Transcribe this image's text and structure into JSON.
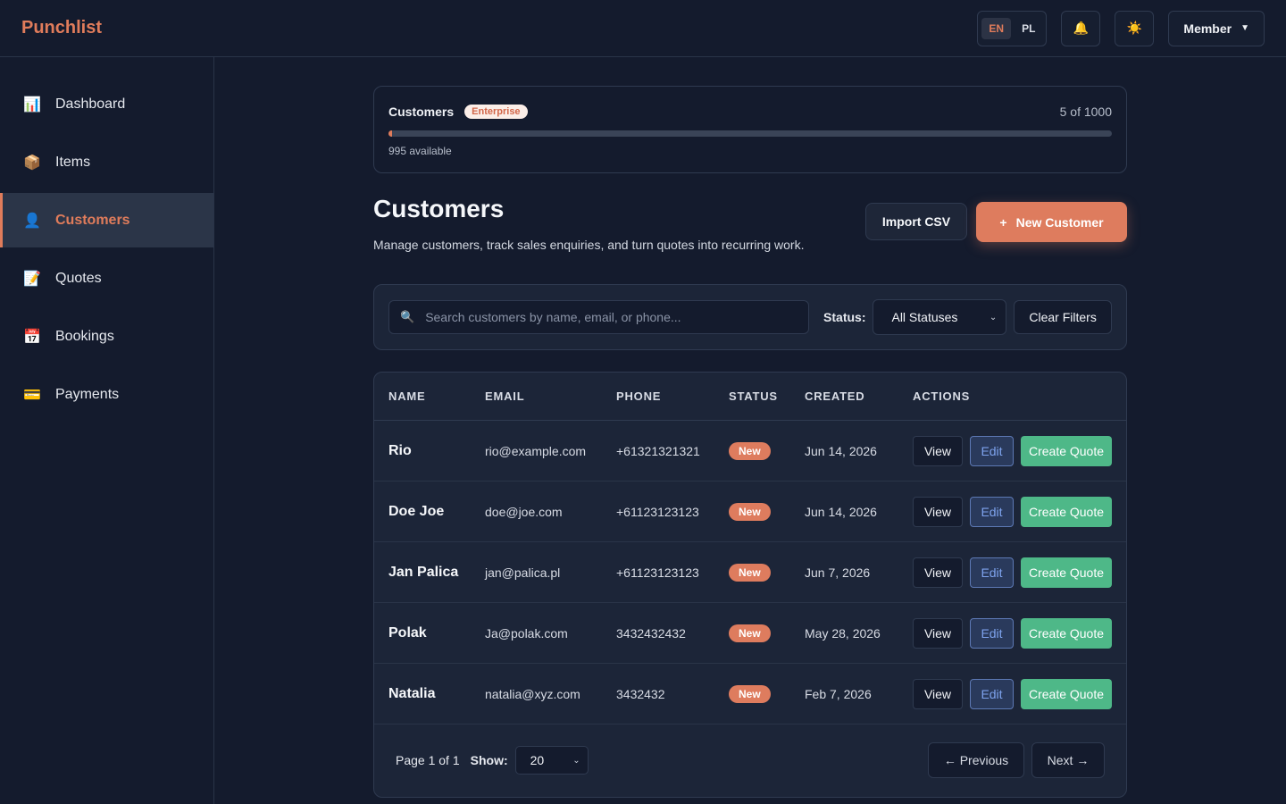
{
  "brand": "Punchlist",
  "topbar": {
    "languages": [
      {
        "code": "EN",
        "active": true
      },
      {
        "code": "PL",
        "active": false
      }
    ],
    "notification_icon": "🔔",
    "theme_icon": "☀️",
    "user_menu_label": "Member",
    "user_menu_caret": "▼"
  },
  "sidebar": {
    "items": [
      {
        "icon": "📊",
        "icon_name": "chart-icon",
        "label": "Dashboard",
        "active": false
      },
      {
        "icon": "📦",
        "icon_name": "package-icon",
        "label": "Items",
        "active": false
      },
      {
        "icon": "👤",
        "icon_name": "user-icon",
        "label": "Customers",
        "active": true
      },
      {
        "icon": "📝",
        "icon_name": "memo-icon",
        "label": "Quotes",
        "active": false
      },
      {
        "icon": "📅",
        "icon_name": "calendar-icon",
        "label": "Bookings",
        "active": false
      },
      {
        "icon": "💳",
        "icon_name": "credit-card-icon",
        "label": "Payments",
        "active": false
      }
    ]
  },
  "usage": {
    "title": "Customers",
    "plan": "Enterprise",
    "count": "5 of 1000",
    "used_fraction": 0.005,
    "available": "995 available",
    "accent_color": "#e07c5b"
  },
  "page": {
    "title": "Customers",
    "description": "Manage customers, track sales enquiries, and turn quotes into recurring work.",
    "import_label": "Import CSV",
    "new_icon": "+",
    "new_label": "New Customer"
  },
  "filters": {
    "search_icon": "🔍",
    "search_placeholder": "Search customers by name, email, or phone...",
    "status_label": "Status:",
    "status_value": "All Statuses",
    "clear_label": "Clear Filters"
  },
  "table": {
    "columns": {
      "name": "NAME",
      "email": "EMAIL",
      "phone": "PHONE",
      "status": "STATUS",
      "created": "CREATED",
      "actions": "ACTIONS"
    },
    "actions": {
      "view": "View",
      "edit": "Edit",
      "quote": "Create Quote"
    },
    "rows": [
      {
        "name": "Rio",
        "email": "rio@example.com",
        "phone": "+61321321321",
        "status": "New",
        "created": "Jun 14, 2026"
      },
      {
        "name": "Doe Joe",
        "email": "doe@joe.com",
        "phone": "+61123123123",
        "status": "New",
        "created": "Jun 14, 2026"
      },
      {
        "name": "Jan Palica",
        "email": "jan@palica.pl",
        "phone": "+61123123123",
        "status": "New",
        "created": "Jun 7, 2026"
      },
      {
        "name": "Polak",
        "email": "Ja@polak.com",
        "phone": "3432432432",
        "status": "New",
        "created": "May 28, 2026"
      },
      {
        "name": "Natalia",
        "email": "natalia@xyz.com",
        "phone": "3432432",
        "status": "New",
        "created": "Feb 7, 2026"
      }
    ]
  },
  "pagination": {
    "page_info": "Page 1 of 1",
    "show_label": "Show:",
    "page_size": "20",
    "previous_label": "← Previous",
    "next_label": "Next →"
  }
}
